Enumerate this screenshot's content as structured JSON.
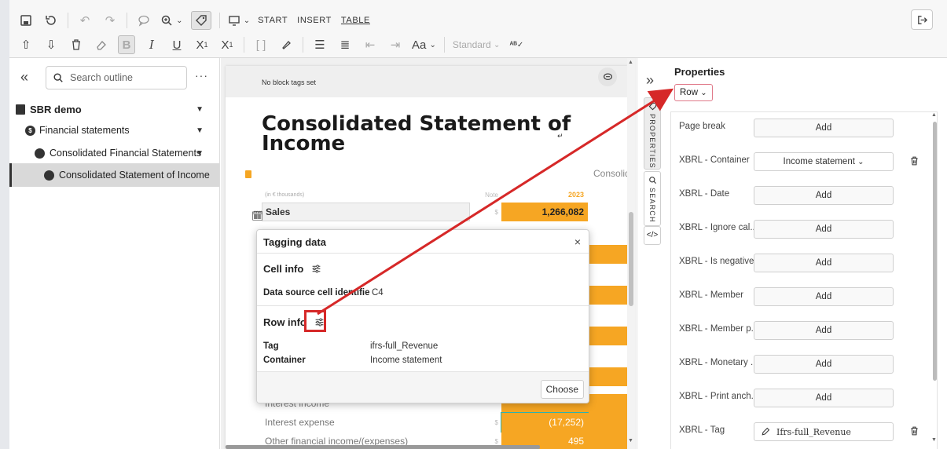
{
  "toolbar": {
    "tabs": [
      "START",
      "INSERT",
      "TABLE"
    ],
    "style_select": "Standard",
    "font_button": "Aa"
  },
  "outline": {
    "search_placeholder": "Search outline",
    "more": "···",
    "items": [
      {
        "label": "SBR demo"
      },
      {
        "label": "Financial statements"
      },
      {
        "label": "Consolidated Financial Statements"
      },
      {
        "label": "Consolidated Statement of Income"
      }
    ]
  },
  "document": {
    "block_tags": "No block tags set",
    "title": "Consolidated Statement of Income",
    "return_mark": "↵",
    "consolidated_label": "Consolida",
    "table": {
      "header": {
        "label": "(in € thousands)",
        "note": "Note",
        "year": "2023"
      },
      "rows": [
        {
          "label": "Sales",
          "sign": "$",
          "value": "1,266,082"
        },
        {
          "label": "Interest income",
          "sign": "",
          "value": ""
        },
        {
          "label": "Interest expense",
          "sign": "$",
          "value": "(17,252)"
        },
        {
          "label": "Other financial income/(expenses)",
          "sign": "$",
          "value": "495"
        }
      ]
    }
  },
  "popup": {
    "title": "Tagging data",
    "close": "×",
    "cell_info": {
      "title": "Cell info",
      "key": "Data source cell identifier",
      "value": "C4"
    },
    "row_info": {
      "title": "Row info",
      "tag_key": "Tag",
      "tag_value": "ifrs-full_Revenue",
      "container_key": "Container",
      "container_value": "Income statement"
    },
    "choose": "Choose"
  },
  "sidetabs": {
    "properties": "PROPERTIES",
    "search": "SEARCH",
    "expand": "»"
  },
  "properties": {
    "title": "Properties",
    "scope": "Row",
    "rows": [
      {
        "label": "Page break",
        "value": "Add"
      },
      {
        "label": "XBRL - Container",
        "value": "Income statement"
      },
      {
        "label": "XBRL - Date",
        "value": "Add"
      },
      {
        "label": "XBRL - Ignore cal...",
        "value": "Add"
      },
      {
        "label": "XBRL - Is negative",
        "value": "Add"
      },
      {
        "label": "XBRL - Member",
        "value": "Add"
      },
      {
        "label": "XBRL - Member p...",
        "value": "Add"
      },
      {
        "label": "XBRL - Monetary ...",
        "value": "Add"
      },
      {
        "label": "XBRL - Print anch...",
        "value": "Add"
      },
      {
        "label": "XBRL - Tag",
        "value": "Ifrs-full_Revenue"
      }
    ]
  },
  "colors": {
    "accent_orange": "#f6a623",
    "annotation_red": "#d62828",
    "selection_teal": "#2db3b3"
  }
}
